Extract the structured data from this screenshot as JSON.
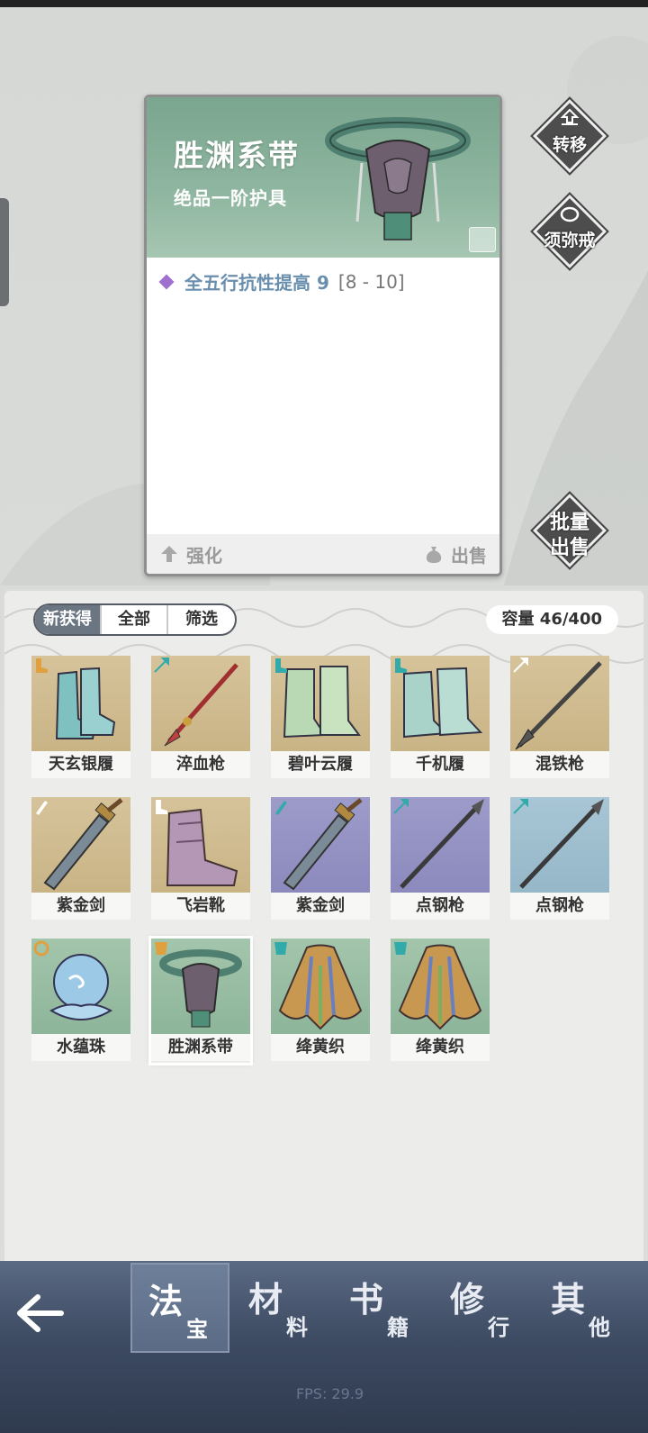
{
  "detail": {
    "name": "胜渊系带",
    "grade": "绝品一阶护具",
    "attribute": "全五行抗性提高 9",
    "attribute_range": "[8 - 10]",
    "enhance_label": "强化",
    "sell_label": "出售"
  },
  "side_buttons": {
    "transfer": "转移",
    "ring": "须弥戒",
    "batch_sell_line1": "批量",
    "batch_sell_line2": "出售"
  },
  "inventory": {
    "tabs": [
      "新获得",
      "全部",
      "筛选"
    ],
    "active_tab": "新获得",
    "capacity": "容量 46/400",
    "items": [
      {
        "name": "天玄银履",
        "slot": "boot",
        "rarity": "gold"
      },
      {
        "name": "淬血枪",
        "slot": "spear",
        "rarity": "gold"
      },
      {
        "name": "碧叶云履",
        "slot": "boot",
        "rarity": "gold"
      },
      {
        "name": "千机履",
        "slot": "boot",
        "rarity": "gold"
      },
      {
        "name": "混铁枪",
        "slot": "spear",
        "rarity": "gold"
      },
      {
        "name": "紫金剑",
        "slot": "sword",
        "rarity": "gold"
      },
      {
        "name": "飞岩靴",
        "slot": "boot",
        "rarity": "gold"
      },
      {
        "name": "紫金剑",
        "slot": "sword",
        "rarity": "purple"
      },
      {
        "name": "点钢枪",
        "slot": "spear",
        "rarity": "purple"
      },
      {
        "name": "点钢枪",
        "slot": "spear",
        "rarity": "blue"
      },
      {
        "name": "水蕴珠",
        "slot": "orb",
        "rarity": "green"
      },
      {
        "name": "胜渊系带",
        "slot": "belt",
        "rarity": "green"
      },
      {
        "name": "绛黄织",
        "slot": "robe",
        "rarity": "green"
      },
      {
        "name": "绛黄织",
        "slot": "robe",
        "rarity": "green"
      }
    ]
  },
  "bottom_nav": [
    {
      "big": "法",
      "small": "宝"
    },
    {
      "big": "材",
      "small": "料"
    },
    {
      "big": "书",
      "small": "籍"
    },
    {
      "big": "修",
      "small": "行"
    },
    {
      "big": "其",
      "small": "他"
    }
  ],
  "active_nav": "法宝",
  "fps": "FPS: 29.9",
  "colors": {
    "card_header": "#8fb6a0",
    "attr_text": "#6a8fae",
    "attr_marker": "#a070d0",
    "nav_bg": "#3d4b63"
  }
}
